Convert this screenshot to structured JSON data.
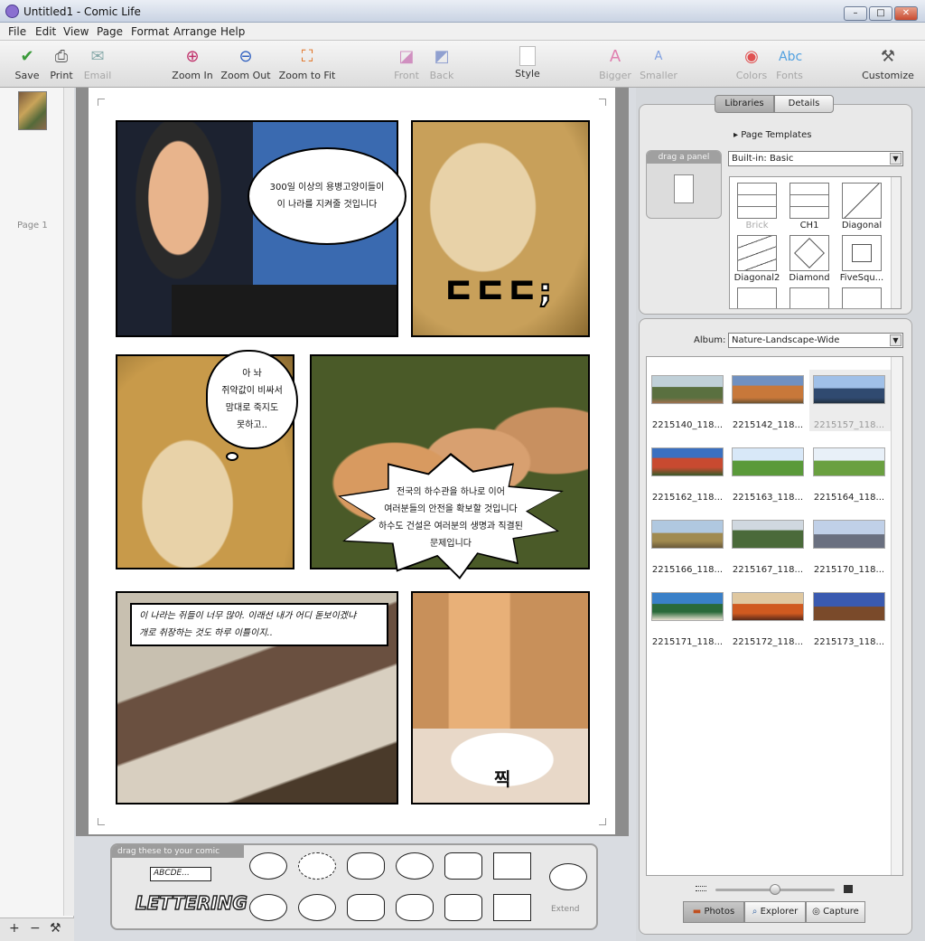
{
  "window": {
    "title": "Untitled1 - Comic Life"
  },
  "menu": [
    "File",
    "Edit",
    "View",
    "Page",
    "Format",
    "Arrange",
    "Help"
  ],
  "toolbar": {
    "save": "Save",
    "print": "Print",
    "email": "Email",
    "zoom_in": "Zoom In",
    "zoom_out": "Zoom Out",
    "zoom_fit": "Zoom to Fit",
    "front": "Front",
    "back": "Back",
    "style": "Style",
    "bigger": "Bigger",
    "smaller": "Smaller",
    "colors": "Colors",
    "fonts": "Fonts",
    "customize": "Customize"
  },
  "pages": {
    "label": "Page 1",
    "add": "+",
    "remove": "−",
    "tools": "⚒"
  },
  "comic": {
    "b1": [
      "300일 이상의 용병고양이들이",
      "이 나라를 지켜줄 것입니다"
    ],
    "b2": "ㄷㄷㄷ;",
    "b3": [
      "아 놔",
      "쥐약값이 비싸서",
      "맘대로 죽지도",
      "못하고.."
    ],
    "b4": [
      "전국의 하수관을 하나로 이어",
      "여러분들의 안전을 확보할 것입니다",
      "하수도 건설은 여러분의 생명과 직결된",
      "문제입니다"
    ],
    "b5": [
      "이 나라는 쥐들이 너무 많아.  이래선 내가 어디 돋보이겠냐",
      "개로 취장하는 것도 하루 이틀이지.."
    ],
    "b6": "찍"
  },
  "palette": {
    "header": "drag these to your comic",
    "abcde": "ABCDE...",
    "lettering": "LETTERING",
    "extend": "Extend"
  },
  "libraries": {
    "tab_libraries": "Libraries",
    "tab_details": "Details",
    "drag_panel": "drag a panel",
    "page_templates": "Page Templates",
    "builtin": "Built-in: Basic",
    "templates": [
      "Brick",
      "CH1",
      "Diagonal",
      "Diagonal2",
      "Diamond",
      "FiveSqu..."
    ]
  },
  "album": {
    "label": "Album:",
    "value": "Nature-Landscape-Wide",
    "photos": [
      "2215140_118...",
      "2215142_118...",
      "2215157_118...",
      "2215162_118...",
      "2215163_118...",
      "2215164_118...",
      "2215166_118...",
      "2215167_118...",
      "2215170_118...",
      "2215171_118...",
      "2215172_118...",
      "2215173_118..."
    ],
    "tabs": [
      "Photos",
      "Explorer",
      "Capture"
    ]
  },
  "colors": {
    "accent": "#1a5fb4"
  }
}
